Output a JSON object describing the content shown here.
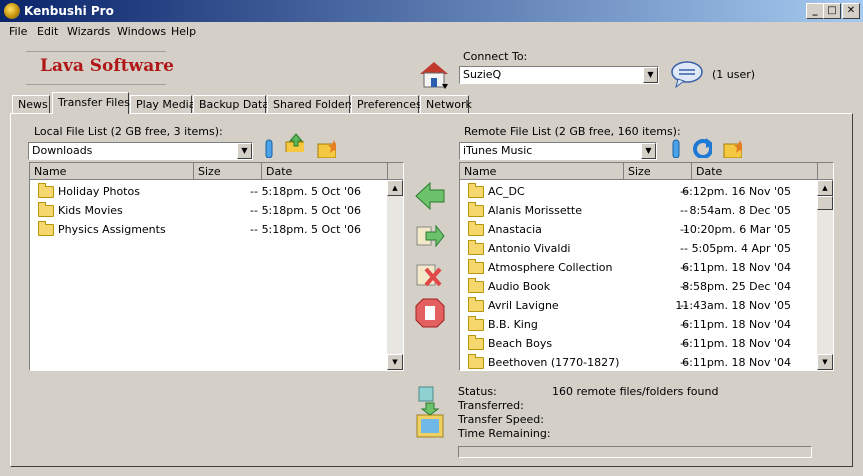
{
  "window": {
    "title": "Kenbushi Pro",
    "min": "_",
    "max": "□",
    "close": "✕"
  },
  "menu": [
    "File",
    "Edit",
    "Wizards",
    "Windows",
    "Help"
  ],
  "logo": "Lava Software",
  "connect": {
    "label": "Connect To:",
    "value": "SuzieQ",
    "users": "(1 user)"
  },
  "tabs": [
    "News",
    "Transfer Files",
    "Play Media",
    "Backup Data",
    "Shared Folders",
    "Preferences",
    "Network"
  ],
  "local": {
    "title": "Local File List (2 GB free, 3 items):",
    "folder": "Downloads",
    "headers": [
      "Name",
      "Size",
      "Date"
    ],
    "rows": [
      {
        "name": "Holiday Photos",
        "size": "--",
        "date": "5:18pm. 5 Oct '06"
      },
      {
        "name": "Kids Movies",
        "size": "--",
        "date": "5:18pm. 5 Oct '06"
      },
      {
        "name": "Physics Assigments",
        "size": "--",
        "date": "5:18pm. 5 Oct '06"
      }
    ]
  },
  "remote": {
    "title": "Remote File List (2 GB free, 160 items):",
    "folder": "iTunes Music",
    "headers": [
      "Name",
      "Size",
      "Date"
    ],
    "rows": [
      {
        "name": "AC_DC",
        "size": "--",
        "date": "6:12pm. 16 Nov '05"
      },
      {
        "name": "Alanis Morissette",
        "size": "--",
        "date": "8:54am. 8 Dec '05"
      },
      {
        "name": "Anastacia",
        "size": "--",
        "date": "10:20pm. 6 Mar '05"
      },
      {
        "name": "Antonio Vivaldi",
        "size": "--",
        "date": "5:05pm. 4 Apr '05"
      },
      {
        "name": "Atmosphere Collection",
        "size": "--",
        "date": "6:11pm. 18 Nov '04"
      },
      {
        "name": "Audio Book",
        "size": "--",
        "date": "8:58pm. 25 Dec '04"
      },
      {
        "name": "Avril Lavigne",
        "size": "--",
        "date": "11:43am. 18 Nov '05"
      },
      {
        "name": "B.B. King",
        "size": "--",
        "date": "6:11pm. 18 Nov '04"
      },
      {
        "name": "Beach Boys",
        "size": "--",
        "date": "6:11pm. 18 Nov '04"
      },
      {
        "name": "Beethoven (1770-1827)",
        "size": "--",
        "date": "6:11pm. 18 Nov '04"
      }
    ]
  },
  "status": {
    "status_label": "Status:",
    "status_value": "160 remote files/folders found",
    "transferred_label": "Transferred:",
    "speed_label": "Transfer Speed:",
    "remaining_label": "Time Remaining:",
    "progress": 0
  }
}
